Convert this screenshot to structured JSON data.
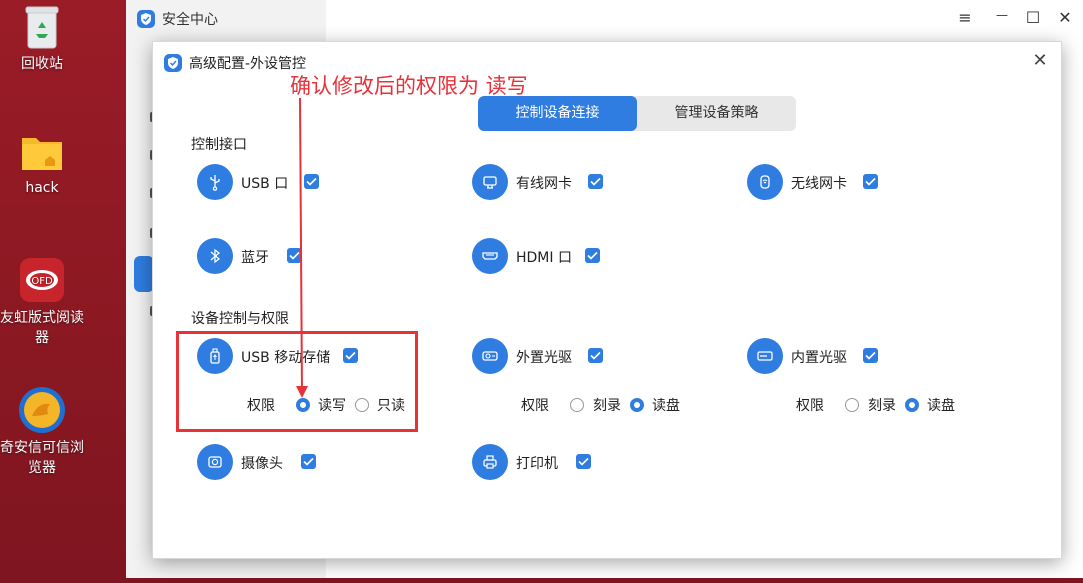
{
  "desktop": {
    "icons": [
      {
        "label": "回收站"
      },
      {
        "label": "hack"
      },
      {
        "label": "友虹版式阅读器"
      },
      {
        "label": "奇安信可信浏览器"
      }
    ]
  },
  "bg_window": {
    "title": "安全中心",
    "controls": {
      "menu": "≡",
      "minimize": "—",
      "maximize": "☐",
      "close": "✕"
    }
  },
  "dialog": {
    "title": "高级配置-外设管控",
    "close": "✕",
    "tabs": [
      {
        "label": "控制设备连接",
        "active": true
      },
      {
        "label": "管理设备策略",
        "active": false
      }
    ],
    "sections": {
      "interfaces": "控制接口",
      "storage": "设备控制与权限"
    },
    "devices": {
      "usb_port": {
        "label": "USB 口",
        "checked": true,
        "icon": "usb-icon"
      },
      "wired_nic": {
        "label": "有线网卡",
        "checked": true,
        "icon": "network-card-icon"
      },
      "wireless_nic": {
        "label": "无线网卡",
        "checked": true,
        "icon": "wifi-card-icon"
      },
      "bluetooth": {
        "label": "蓝牙",
        "checked": true,
        "icon": "bluetooth-icon"
      },
      "hdmi": {
        "label": "HDMI 口",
        "checked": true,
        "icon": "hdmi-icon"
      },
      "usb_storage": {
        "label": "USB 移动存储",
        "checked": true,
        "icon": "usb-storage-icon",
        "perm_label": "权限",
        "options": [
          "读写",
          "只读"
        ],
        "selected": "读写"
      },
      "external_optical": {
        "label": "外置光驱",
        "checked": true,
        "icon": "optical-drive-icon",
        "perm_label": "权限",
        "options": [
          "刻录",
          "读盘"
        ],
        "selected": "读盘"
      },
      "internal_optical": {
        "label": "内置光驱",
        "checked": true,
        "icon": "internal-drive-icon",
        "perm_label": "权限",
        "options": [
          "刻录",
          "读盘"
        ],
        "selected": "读盘"
      },
      "camera": {
        "label": "摄像头",
        "checked": true,
        "icon": "camera-icon"
      },
      "printer": {
        "label": "打印机",
        "checked": true,
        "icon": "printer-icon"
      }
    }
  },
  "annotation": {
    "text": "确认修改后的权限为 读写",
    "color": "#e8323a"
  },
  "colors": {
    "accent": "#2f7de1",
    "desktop_bg": "#8e1a24"
  }
}
